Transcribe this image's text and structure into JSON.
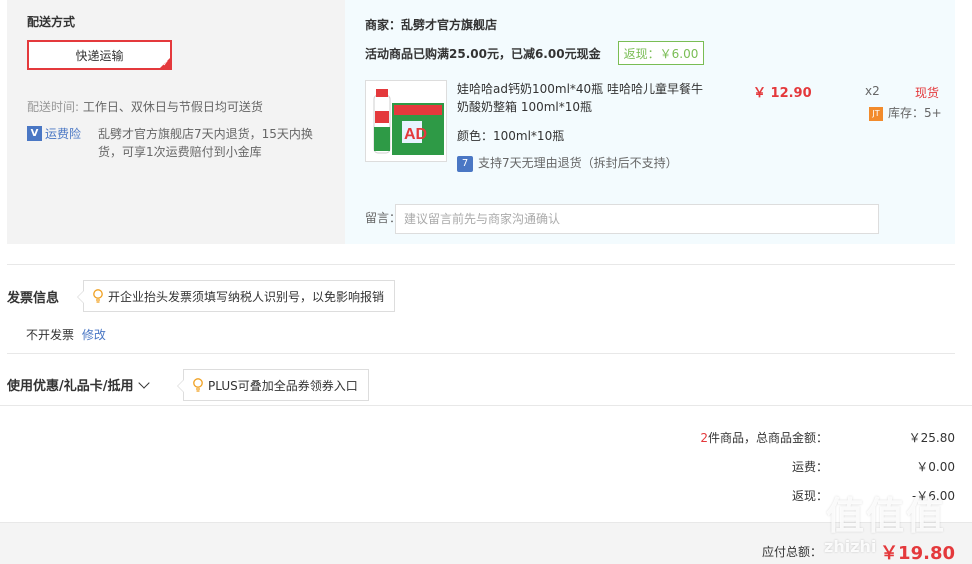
{
  "shipping": {
    "section_title": "配送方式",
    "method_button": "快递运输",
    "time_label": "配送时间:",
    "time_value": "工作日、双休日与节假日均可送货",
    "insurance_icon": "shield-v-icon",
    "insurance_label": "运费险",
    "insurance_desc": "乱劈才官方旗舰店7天内退货，15天内换货，可享1次运费赔付到小金库"
  },
  "order": {
    "merchant": "商家：乱劈才官方旗舰店",
    "promo_text": "活动商品已购满25.00元，已减6.00元现金",
    "cashback_tag": "返现：￥6.00",
    "product": {
      "image_icon": "milk-drink-product-image",
      "name": "娃哈哈ad钙奶100ml*40瓶 哇哈哈儿童早餐牛奶酸奶整箱 100ml*10瓶",
      "color": "颜色：100ml*10瓶",
      "return_policy": "支持7天无理由退货（拆封后不支持）",
      "price": "￥ 12.90",
      "quantity": "x2",
      "stock_status": "现货",
      "stock_label": "库存：5+"
    },
    "message_label": "留言：",
    "message_placeholder": "建议留言前先与商家沟通确认"
  },
  "invoice": {
    "title": "发票信息",
    "tip": "开企业抬头发票须填写纳税人识别号，以免影响报销",
    "value": "不开发票",
    "edit_link": "修改"
  },
  "coupon": {
    "title": "使用优惠/礼品卡/抵用",
    "tip": "PLUS可叠加全品券领券入口"
  },
  "summary": {
    "count": "2",
    "count_suffix": "件商品，总商品金额：",
    "goods_total": "￥25.80",
    "shipping_label": "运费：",
    "shipping_fee": "￥0.00",
    "cashback_label": "返现：",
    "cashback_value": "-￥6.00",
    "payable_label": "应付总额：",
    "payable_value": "￥19.80"
  },
  "watermark": {
    "glyphs": "值值值",
    "site": "zhizhi"
  },
  "colors": {
    "accent_red": "#e4393c",
    "link_blue": "#4a77c4",
    "cashback_green": "#7abd54",
    "jd_orange": "#f28b2c"
  }
}
